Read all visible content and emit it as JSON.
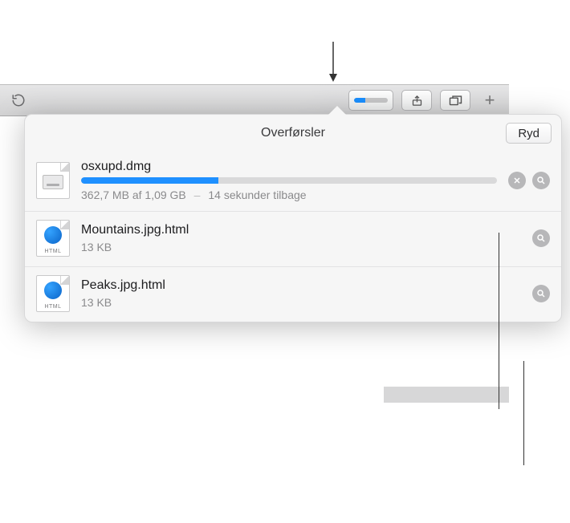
{
  "toolbar": {
    "downloads_progress_pct": 33
  },
  "popover": {
    "title": "Overførsler",
    "clear_label": "Ryd"
  },
  "downloads": [
    {
      "name": "osxupd.dmg",
      "kind": "dmg",
      "progress_pct": 33,
      "bytes_done": "362,7 MB",
      "bytes_total": "1,09 GB",
      "size_sep_word": "af",
      "time_remaining": "14 sekunder tilbage",
      "in_progress": true
    },
    {
      "name": "Mountains.jpg.html",
      "kind": "html",
      "size": "13 KB",
      "in_progress": false
    },
    {
      "name": "Peaks.jpg.html",
      "kind": "html",
      "size": "13 KB",
      "in_progress": false
    }
  ],
  "icon_labels": {
    "html": "HTML"
  }
}
